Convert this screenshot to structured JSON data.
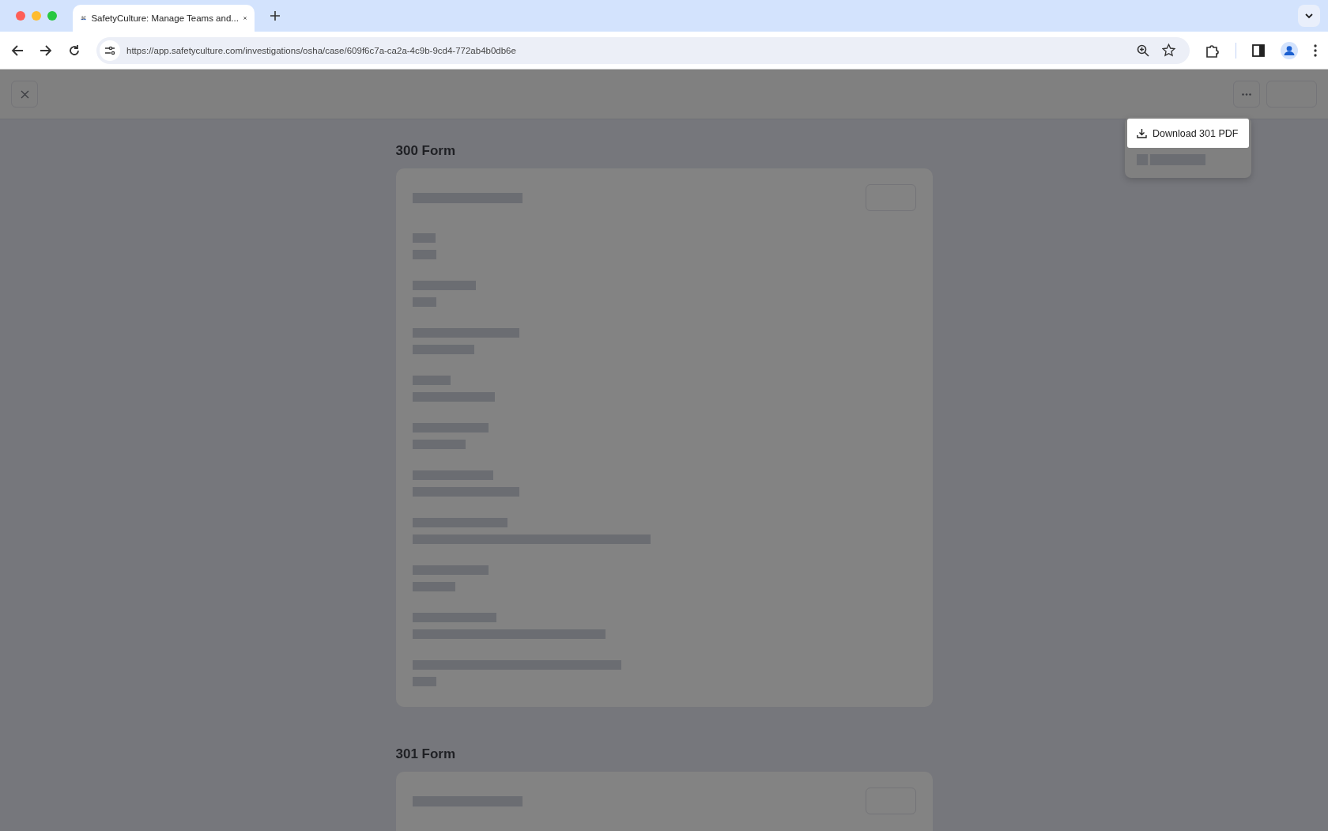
{
  "browser": {
    "tab_title": "SafetyCulture: Manage Teams and...",
    "url": "https://app.safetyculture.com/investigations/osha/case/609f6c7a-ca2a-4c9b-9cd4-772ab4b0db6e"
  },
  "sections": [
    {
      "title": "300 Form"
    },
    {
      "title": "301 Form"
    }
  ],
  "menu": {
    "items": [
      {
        "label": "Download 301 PDF"
      }
    ]
  }
}
